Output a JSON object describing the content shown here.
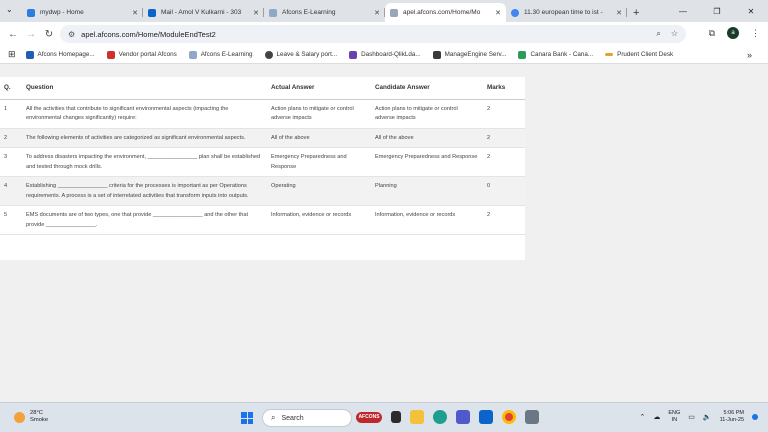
{
  "tabs": [
    {
      "title": "mydwp - Home",
      "color": "#2a7de1"
    },
    {
      "title": "Mail - Amol V Kulkarni - 303",
      "color": "#0a64c9"
    },
    {
      "title": "Afcons E-Learning",
      "color": "#8fa7c9"
    },
    {
      "title": "apel.afcons.com/Home/Mo",
      "color": "#9aa7b8"
    },
    {
      "title": "11.30 european time to ist -",
      "color": "#4285f4"
    }
  ],
  "address": {
    "url": "apel.afcons.com/Home/ModuleEndTest2"
  },
  "profile_initial": "a",
  "bookmarks": [
    {
      "label": "Afcons Homepage...",
      "color": "#1e5fb3"
    },
    {
      "label": "Vendor portal Afcons",
      "color": "#d0302b"
    },
    {
      "label": "Afcons E-Learning",
      "color": "#8fa7c9"
    },
    {
      "label": "Leave & Salary port...",
      "color": "#444444"
    },
    {
      "label": "Dashboard-QlikLda...",
      "color": "#6a3fb0"
    },
    {
      "label": "ManageEngine Serv...",
      "color": "#3a3a3a"
    },
    {
      "label": "Canara Bank - Cana...",
      "color": "#2a9d5a"
    },
    {
      "label": "Prudent Client Desk",
      "color": "#e2a42b"
    }
  ],
  "table": {
    "headers": [
      "Q.",
      "Question",
      "Actual Answer",
      "Candidate Answer",
      "Marks"
    ],
    "rows": [
      {
        "n": "1",
        "q": "All the activities that contribute to significant environmental aspects (impacting the environmental changes significantly) require:",
        "actual": "Action plans to mitigate or control adverse impacts",
        "candidate": "Action plans to mitigate or control adverse impacts",
        "marks": "2"
      },
      {
        "n": "2",
        "q": "The following elements of activities are categorized as significant environmental aspects.",
        "actual": "All of the above",
        "candidate": "All of the above",
        "marks": "2"
      },
      {
        "n": "3",
        "q": "To address disasters impacting the environment, ________________ plan shall be established and tested through mock drills.",
        "actual": "Emergency Preparedness and Response",
        "candidate": "Emergency Preparedness and Response",
        "marks": "2"
      },
      {
        "n": "4",
        "q": "Establishing ________________ criteria for the processes is important as per Operations requirements. A process is a set of interrelated activities that transform inputs into outputs.",
        "actual": "Operating",
        "candidate": "Planning",
        "marks": "0"
      },
      {
        "n": "5",
        "q": "EMS documents are of two types, one that provide ________________ and the other that provide ________________.",
        "actual": "Information, evidence or records",
        "candidate": "Information, evidence or records",
        "marks": "2"
      }
    ]
  },
  "taskbar": {
    "weather_temp": "28°C",
    "weather_desc": "Smoke",
    "search_placeholder": "Search",
    "lang_top": "ENG",
    "lang_bottom": "IN",
    "time": "5:06 PM",
    "date": "11-Jun-25"
  }
}
